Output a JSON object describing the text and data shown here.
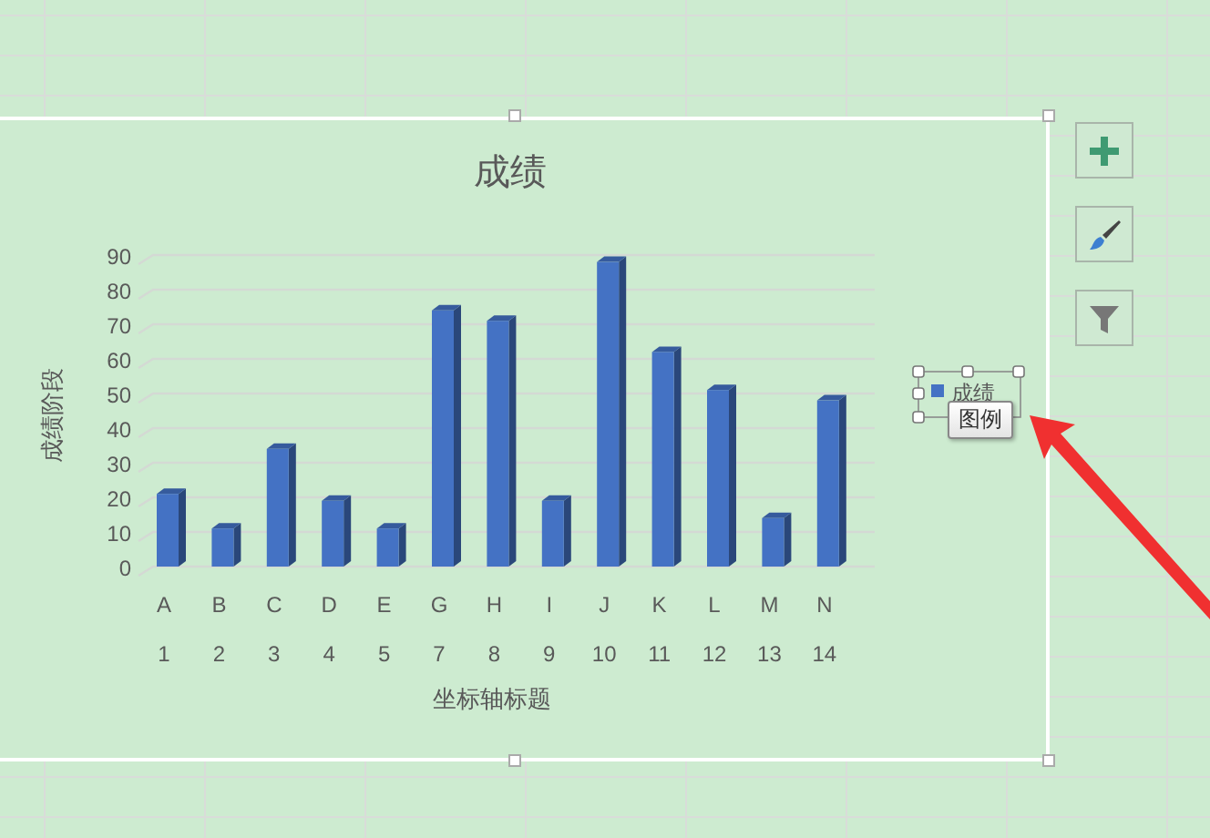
{
  "chart": {
    "chart_data": {
      "type": "bar",
      "title": "成绩",
      "xlabel": "坐标轴标题",
      "ylabel": "成绩阶段",
      "categories": [
        [
          "A",
          "1"
        ],
        [
          "B",
          "2"
        ],
        [
          "C",
          "3"
        ],
        [
          "D",
          "4"
        ],
        [
          "E",
          "5"
        ],
        [
          "G",
          "7"
        ],
        [
          "H",
          "8"
        ],
        [
          "I",
          "9"
        ],
        [
          "J",
          "10"
        ],
        [
          "K",
          "11"
        ],
        [
          "L",
          "12"
        ],
        [
          "M",
          "13"
        ],
        [
          "N",
          "14"
        ]
      ],
      "series": [
        {
          "name": "成绩",
          "color": "#4472c4",
          "values": [
            21,
            11,
            34,
            19,
            11,
            74,
            71,
            19,
            88,
            62,
            51,
            14,
            48
          ]
        }
      ],
      "ylim": [
        0,
        90
      ],
      "yticks": [
        0,
        10,
        20,
        30,
        40,
        50,
        60,
        70,
        80,
        90
      ]
    },
    "legend_tooltip": "图例"
  }
}
